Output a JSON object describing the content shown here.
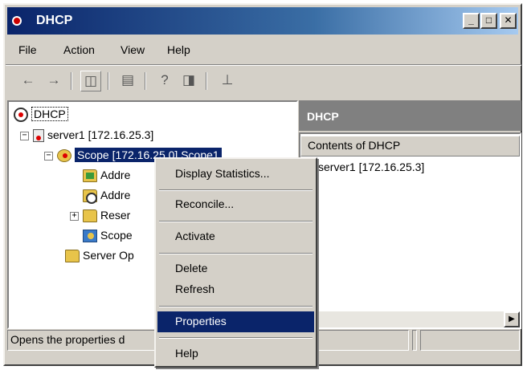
{
  "window": {
    "title": "DHCP",
    "controls": {
      "minimize": "_",
      "maximize": "□",
      "close": "✕"
    }
  },
  "menubar": {
    "items": [
      "File",
      "Action",
      "View",
      "Help"
    ]
  },
  "toolbar": {
    "icons": [
      "back-arrow-icon",
      "forward-arrow-icon",
      "show-hide-tree-icon",
      "export-list-icon",
      "help-icon",
      "show-hide-action-pane-icon",
      "server-status-icon"
    ]
  },
  "tree": {
    "root": "DHCP",
    "server": "server1 [172.16.25.3]",
    "scope": "Scope [172.16.25.0] Scope1",
    "children": [
      "Addre",
      "Addre",
      "Reser",
      "Scope"
    ],
    "server_options": "Server Op"
  },
  "right_pane": {
    "header": "DHCP",
    "column_header": "Contents of DHCP",
    "items": [
      "server1 [172.16.25.3]"
    ]
  },
  "context_menu": {
    "items": [
      "Display Statistics...",
      "Reconcile...",
      "Activate",
      "Delete",
      "Refresh",
      "Properties",
      "Help"
    ],
    "highlighted": "Properties"
  },
  "status_bar": {
    "text": "Opens the properties d"
  }
}
